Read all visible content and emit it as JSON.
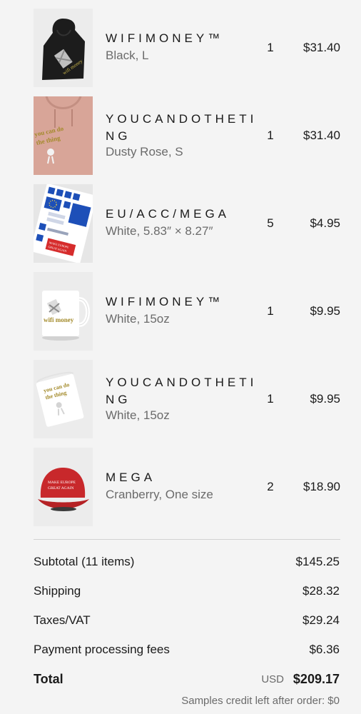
{
  "items": [
    {
      "name": "WIFIMONEY™",
      "variant": "Black, L",
      "qty": "1",
      "price": "$31.40",
      "image": "black-hoodie"
    },
    {
      "name": "YOUCANDOTHETING",
      "variant": "Dusty Rose, S",
      "qty": "1",
      "price": "$31.40",
      "image": "pink-hoodie"
    },
    {
      "name": "EU/ACC/MEGA",
      "variant": "White, 5.83″ × 8.27″",
      "qty": "5",
      "price": "$4.95",
      "image": "sticker-sheet"
    },
    {
      "name": "WIFIMONEY™",
      "variant": "White, 15oz",
      "qty": "1",
      "price": "$9.95",
      "image": "white-mug"
    },
    {
      "name": "YOUCANDOTHETING",
      "variant": "White, 15oz",
      "qty": "1",
      "price": "$9.95",
      "image": "white-mug"
    },
    {
      "name": "MEGA",
      "variant": "Cranberry, One size",
      "qty": "2",
      "price": "$18.90",
      "image": "red-cap"
    }
  ],
  "summary": {
    "subtotal_label": "Subtotal (11 items)",
    "subtotal_value": "$145.25",
    "shipping_label": "Shipping",
    "shipping_value": "$28.32",
    "taxes_label": "Taxes/VAT",
    "taxes_value": "$29.24",
    "fees_label": "Payment processing fees",
    "fees_value": "$6.36",
    "total_label": "Total",
    "total_currency": "USD",
    "total_value": "$209.17",
    "credit_note": "Samples credit left after order: $0"
  },
  "product_art": {
    "cap_text_1": "MAKE EUROPE",
    "cap_text_2": "GREAT AGAIN",
    "hoodie_print": "wifi money",
    "mug_print": "wifi money",
    "pink_print": "you can do the thing"
  },
  "colors": {
    "black_hoodie": "#1c1c1c",
    "pink_hoodie": "#d9a79b",
    "cap": "#c8282b",
    "mug": "#ffffff"
  }
}
